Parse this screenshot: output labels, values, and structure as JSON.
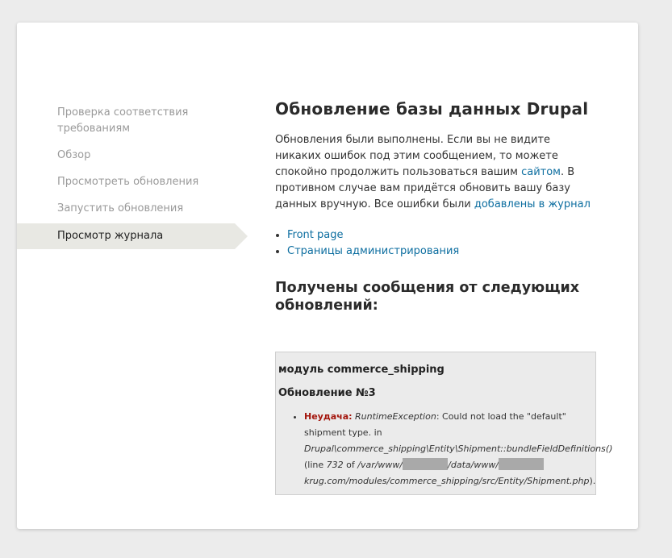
{
  "sidebar": {
    "items": [
      {
        "label": "Проверка соответствия требованиям"
      },
      {
        "label": "Обзор"
      },
      {
        "label": "Просмотреть обновления"
      },
      {
        "label": "Запустить обновления"
      },
      {
        "label": "Просмотр журнала"
      }
    ]
  },
  "main": {
    "title": "Обновление базы данных Drupal",
    "intro_part1": "Обновления были выполнены. Если вы не видите никаких ошибок под этим сообщением, то можете спокойно продолжить пользоваться вашим ",
    "intro_link_site": "сайтом",
    "intro_part2": ". В противном случае вам придётся обновить вашу базу данных вручную. Все ошибки были ",
    "intro_link_log": "добавлены в журнал",
    "links": [
      "Front page",
      "Страницы администрирования"
    ],
    "messages_title": "Получены сообщения от следующих обновлений:"
  },
  "log": {
    "module": "модуль commerce_shipping",
    "update": "Обновление №3",
    "fail_label": "Неудача:",
    "exception": "RuntimeException",
    "msg1": ": Could not load the \"default\" shipment type. in",
    "func": "Drupal\\commerce_shipping\\Entity\\Shipment::bundleFieldDefinitions()",
    "line_prefix": "(line ",
    "line_num": "732",
    "line_of": " of ",
    "path1": "/var/www/",
    "path2": "/data/www/",
    "path3": "krug.com/modules/commerce_shipping/src/Entity/Shipment.php",
    "path_end": ")."
  }
}
